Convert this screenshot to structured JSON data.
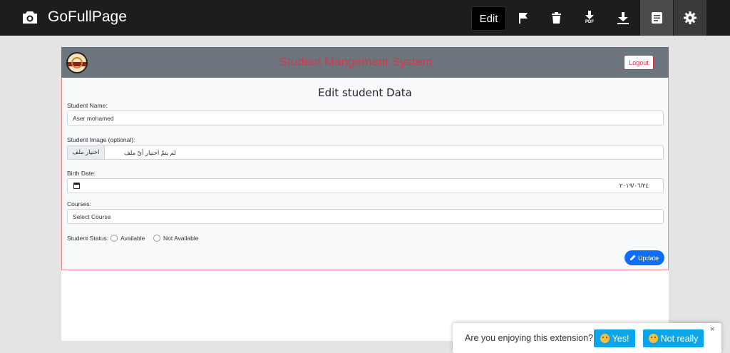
{
  "extension": {
    "brand": "GoFullPage",
    "edit_label": "Edit",
    "pdf_label": "PDF"
  },
  "app": {
    "title": "Student Mangement System",
    "logout_label": "Logout"
  },
  "form": {
    "title": "Edit student Data",
    "name_label": "Student Name:",
    "name_value": "Aser mohamed",
    "image_label": "Student Image (optional):",
    "file_button_label": "اختيار ملف",
    "file_status": "لم يتمّ اختيار أيّ ملف",
    "birth_label": "Birth Date:",
    "birth_value": "٢٠١٩/٠٦/٢٤",
    "courses_label": "Courses:",
    "courses_value": "Select Course",
    "status_label": "Student Status:",
    "status_options": [
      "Available",
      "Not Available"
    ],
    "update_label": "Update"
  },
  "toast": {
    "question": "Are you enjoying this extension?",
    "yes_label": "Yes!",
    "no_label": "Not really",
    "close_label": "×"
  },
  "colors": {
    "accent_red": "#dc3545",
    "primary_blue": "#0d6efd",
    "toast_blue": "#0ba5ec"
  }
}
